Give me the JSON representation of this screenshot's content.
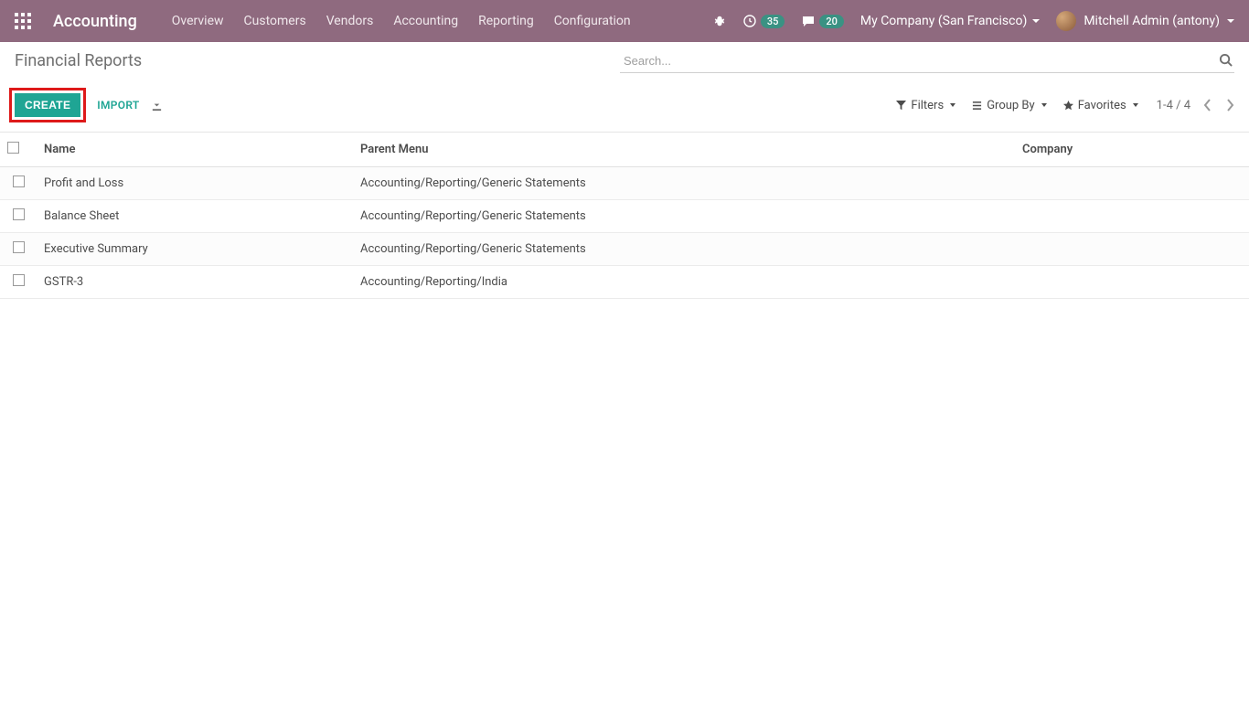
{
  "navbar": {
    "app_title": "Accounting",
    "links": [
      "Overview",
      "Customers",
      "Vendors",
      "Accounting",
      "Reporting",
      "Configuration"
    ],
    "timer_badge": "35",
    "chat_badge": "20",
    "company": "My Company (San Francisco)",
    "user": "Mitchell Admin (antony)"
  },
  "control_panel": {
    "title": "Financial Reports",
    "search_placeholder": "Search...",
    "create_label": "CREATE",
    "import_label": "IMPORT",
    "filters_label": "Filters",
    "group_by_label": "Group By",
    "favorites_label": "Favorites",
    "pager": "1-4 / 4"
  },
  "table": {
    "columns": {
      "name": "Name",
      "parent": "Parent Menu",
      "company": "Company"
    },
    "rows": [
      {
        "name": "Profit and Loss",
        "parent": "Accounting/Reporting/Generic Statements",
        "company": ""
      },
      {
        "name": "Balance Sheet",
        "parent": "Accounting/Reporting/Generic Statements",
        "company": ""
      },
      {
        "name": "Executive Summary",
        "parent": "Accounting/Reporting/Generic Statements",
        "company": ""
      },
      {
        "name": "GSTR-3",
        "parent": "Accounting/Reporting/India",
        "company": ""
      }
    ]
  }
}
